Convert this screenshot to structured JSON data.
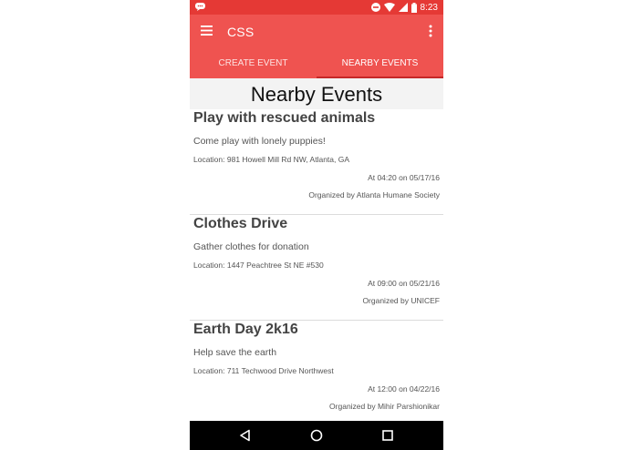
{
  "status_bar": {
    "time": "8:23"
  },
  "app_bar": {
    "title": "CSS"
  },
  "tabs": [
    {
      "label": "CREATE EVENT",
      "active": false
    },
    {
      "label": "NEARBY EVENTS",
      "active": true
    }
  ],
  "page": {
    "heading": "Nearby Events"
  },
  "events": [
    {
      "title": "Play with rescued animals",
      "description": "Come play with lonely puppies!",
      "location": "Location: 981 Howell Mill Rd NW, Atlanta, GA",
      "time": "At 04:20 on 05/17/16",
      "organizer": "Organized by Atlanta Humane Society"
    },
    {
      "title": "Clothes Drive",
      "description": "Gather clothes for donation",
      "location": "Location: 1447 Peachtree St NE #530",
      "time": "At 09:00 on 05/21/16",
      "organizer": "Organized by UNICEF"
    },
    {
      "title": "Earth Day 2k16",
      "description": "Help save the earth",
      "location": "Location: 711 Techwood Drive Northwest",
      "time": "At 12:00 on 04/22/16",
      "organizer": "Organized by Mihir Parshionikar"
    }
  ],
  "colors": {
    "status_bar": "#e53935",
    "app_bar": "#ef5350",
    "tab_indicator": "#c62828"
  },
  "icons": [
    "notification-icon",
    "dnd-icon",
    "wifi-icon",
    "signal-icon",
    "battery-icon",
    "menu-icon",
    "overflow-icon",
    "back-icon",
    "home-icon",
    "recents-icon"
  ]
}
